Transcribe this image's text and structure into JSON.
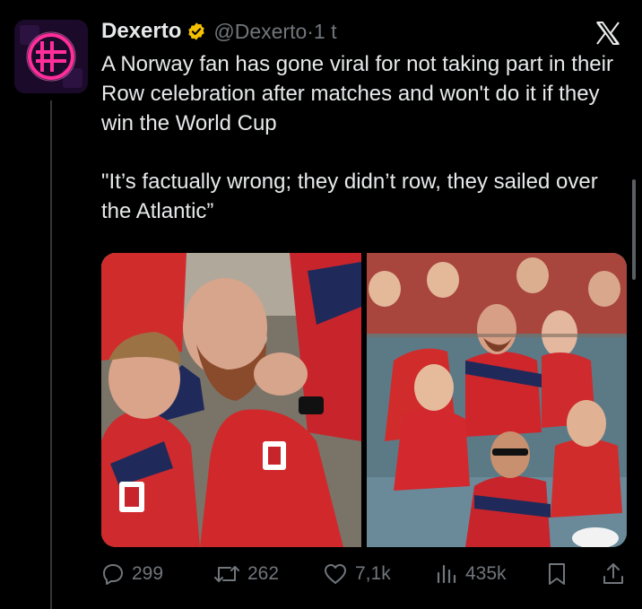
{
  "tweet": {
    "author_name": "Dexerto",
    "handle_time": "@Dexerto·1 t",
    "text_paragraph_1": "A Norway fan has gone viral for not taking part in their Row celebration after matches and won't do it if they win the World Cup",
    "text_paragraph_2": "\"It’s factually wrong; they didn’t row, they sailed over the Atlantic”"
  },
  "actions": {
    "replies": "299",
    "retweets": "262",
    "likes": "7,1k",
    "views": "435k"
  },
  "icons": {
    "avatar": "dexerto-logo-icon",
    "verified": "verified-badge-icon",
    "platform": "x-logo-icon",
    "reply": "reply-icon",
    "retweet": "retweet-icon",
    "like": "heart-icon",
    "views": "views-icon",
    "bookmark": "bookmark-icon",
    "share": "share-icon"
  },
  "colors": {
    "background": "#000000",
    "text": "#e7e9ea",
    "secondary": "#71767b",
    "verified": "#f4c000",
    "brand_pink": "#ff2e9a"
  }
}
